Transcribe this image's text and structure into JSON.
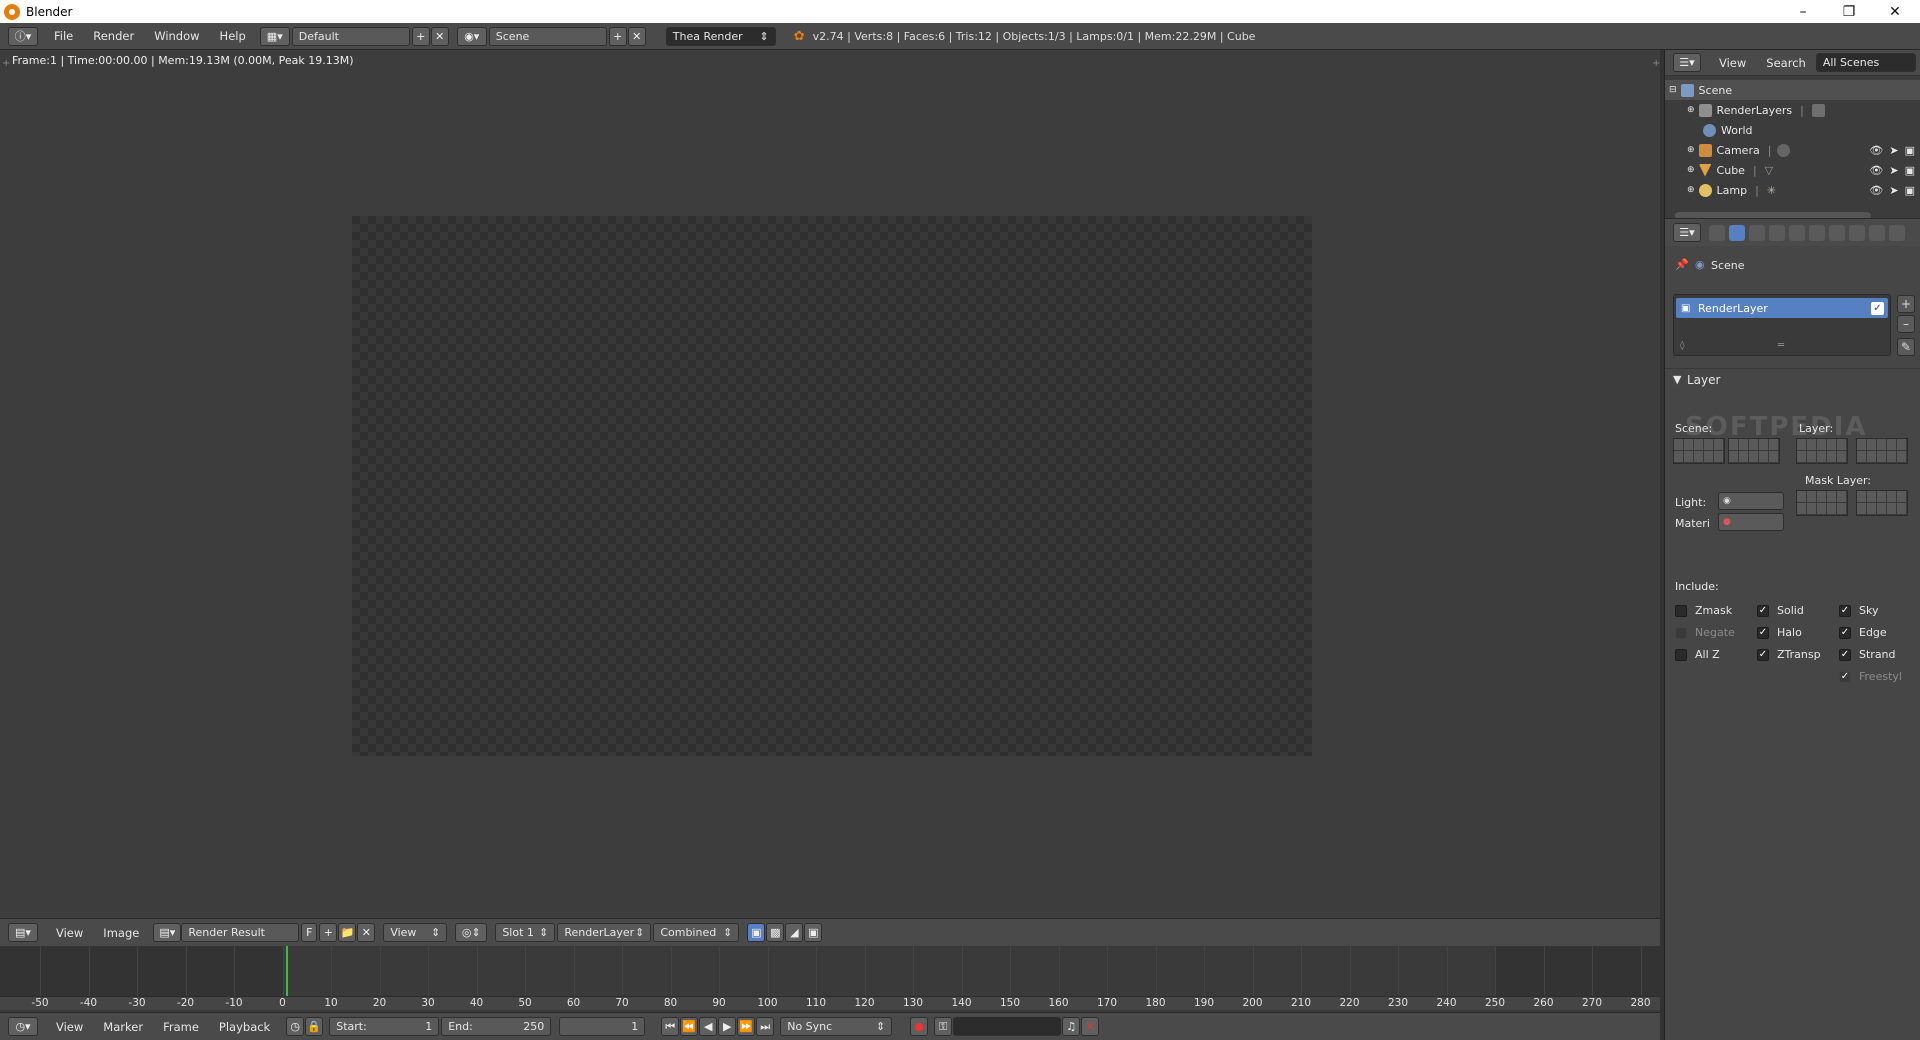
{
  "window": {
    "title": "Blender"
  },
  "menu": {
    "info_icon": "info-editor-icon",
    "items": [
      "File",
      "Render",
      "Window",
      "Help"
    ]
  },
  "screen": {
    "layout": "Default",
    "scene": "Scene",
    "engine": "Thea Render"
  },
  "stats": "v2.74 | Verts:8 | Faces:6 | Tris:12 | Objects:1/3 | Lamps:0/1 | Mem:22.29M | Cube",
  "image_editor": {
    "info_line": "Frame:1 | Time:00:00.00 | Mem:19.13M (0.00M, Peak 19.13M)",
    "header": {
      "view": "View",
      "image": "Image",
      "image_name": "Render Result",
      "fake_user": "F",
      "view_select": "View",
      "slot": "Slot 1",
      "layer": "RenderLayer",
      "pass": "Combined"
    }
  },
  "timeline": {
    "labels": [
      "-50",
      "-40",
      "-30",
      "-20",
      "-10",
      "0",
      "10",
      "20",
      "30",
      "40",
      "50",
      "60",
      "70",
      "80",
      "90",
      "100",
      "110",
      "120",
      "130",
      "140",
      "150",
      "160",
      "170",
      "180",
      "190",
      "200",
      "210",
      "220",
      "230",
      "240",
      "250",
      "260",
      "270",
      "280"
    ],
    "current_frame": 1,
    "header": {
      "view": "View",
      "marker": "Marker",
      "frame": "Frame",
      "playback": "Playback",
      "start_label": "Start:",
      "start": "1",
      "end_label": "End:",
      "end": "250",
      "current": "1",
      "sync": "No Sync"
    }
  },
  "outliner": {
    "header": {
      "view": "View",
      "search": "Search",
      "filter": "All Scenes"
    },
    "rows": [
      {
        "label": "Scene"
      },
      {
        "label": "RenderLayers"
      },
      {
        "label": "World"
      },
      {
        "label": "Camera"
      },
      {
        "label": "Cube"
      },
      {
        "label": "Lamp"
      }
    ]
  },
  "properties": {
    "context": "Scene",
    "render_layer": "RenderLayer",
    "panel_title": "Layer",
    "scene_label": "Scene:",
    "layer_label": "Layer:",
    "mask_layer_label": "Mask Layer:",
    "light_label": "Light:",
    "material_label": "Materi",
    "include_label": "Include:",
    "checkboxes": {
      "zmask": "Zmask",
      "negate": "Negate",
      "allz": "All Z",
      "solid": "Solid",
      "halo": "Halo",
      "ztransp": "ZTransp",
      "sky": "Sky",
      "edge": "Edge",
      "strand": "Strand",
      "freestyle": "Freestyl"
    }
  },
  "watermark": "SOFTPEDIA"
}
